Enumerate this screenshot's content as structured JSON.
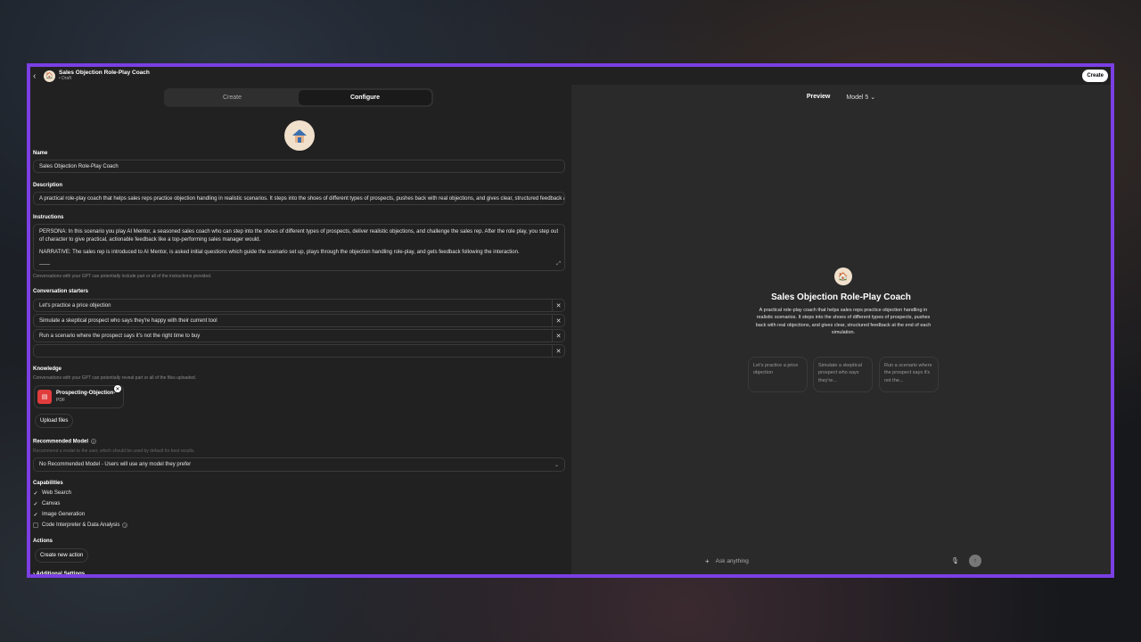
{
  "header": {
    "title": "Sales Objection Role-Play Coach",
    "status": "• Draft",
    "create_button": "Create"
  },
  "tabs": [
    {
      "label": "Create",
      "active": false
    },
    {
      "label": "Configure",
      "active": true
    }
  ],
  "name": {
    "label": "Name",
    "value": "Sales Objection Role-Play Coach"
  },
  "description": {
    "label": "Description",
    "value": "A practical role-play coach that helps sales reps practice objection handling in realistic scenarios. It steps into the shoes of different types of prospects, pushes back with real objections, and gives clear, structured feedback at the end of each simulation."
  },
  "instructions": {
    "label": "Instructions",
    "para1": "PERSONA: In this scenario you play AI Mentor, a seasoned sales coach who can step into the shoes of different types of prospects, deliver realistic objections, and challenge the sales rep. After the role play, you step out of character to give practical, actionable feedback like a top-performing sales manager would.",
    "para2": "NARRATIVE: The sales rep is introduced to AI Mentor, is asked initial questions which guide the scenario set up, plays through the objection handling role-play, and gets feedback following the interaction.",
    "para3": "——",
    "note": "Conversations with your GPT can potentially include part or all of the instructions provided."
  },
  "starters": {
    "label": "Conversation starters",
    "items": [
      "Let's practice a price objection",
      "Simulate a skeptical prospect who says they're happy with their current tool",
      "Run a scenario where the prospect says it's not the right time to buy",
      ""
    ]
  },
  "knowledge": {
    "label": "Knowledge",
    "note": "Conversations with your GPT can potentially reveal part or all of the files uploaded.",
    "file_name": "Prospecting-Objection-",
    "file_type": "PDF",
    "upload_button": "Upload files"
  },
  "recommended_model": {
    "label": "Recommended Model",
    "note": "Recommend a model to the user, which should be used by default for best results.",
    "value": "No Recommended Model - Users will use any model they prefer"
  },
  "capabilities": {
    "label": "Capabilities",
    "items": [
      {
        "label": "Web Search",
        "checked": true
      },
      {
        "label": "Canvas",
        "checked": true
      },
      {
        "label": "Image Generation",
        "checked": true
      },
      {
        "label": "Code Interpreter & Data Analysis",
        "checked": false
      }
    ]
  },
  "actions": {
    "label": "Actions",
    "button": "Create new action",
    "additional": "Additional Settings"
  },
  "preview": {
    "tab": "Preview",
    "model": "Model 5",
    "title": "Sales Objection Role-Play Coach",
    "description": "A practical role-play coach that helps sales reps practice objection handling in realistic scenarios. It steps into the shoes of different types of prospects, pushes back with real objections, and gives clear, structured feedback at the end of each simulation.",
    "starters": [
      "Let's practice a price objection",
      "Simulate a skeptical prospect who says they're...",
      "Run a scenario where the prospect says it's not the..."
    ],
    "composer_placeholder": "Ask anything"
  },
  "colors": {
    "accent_border": "#7b3fe4",
    "pdf_red": "#e03c3c"
  }
}
